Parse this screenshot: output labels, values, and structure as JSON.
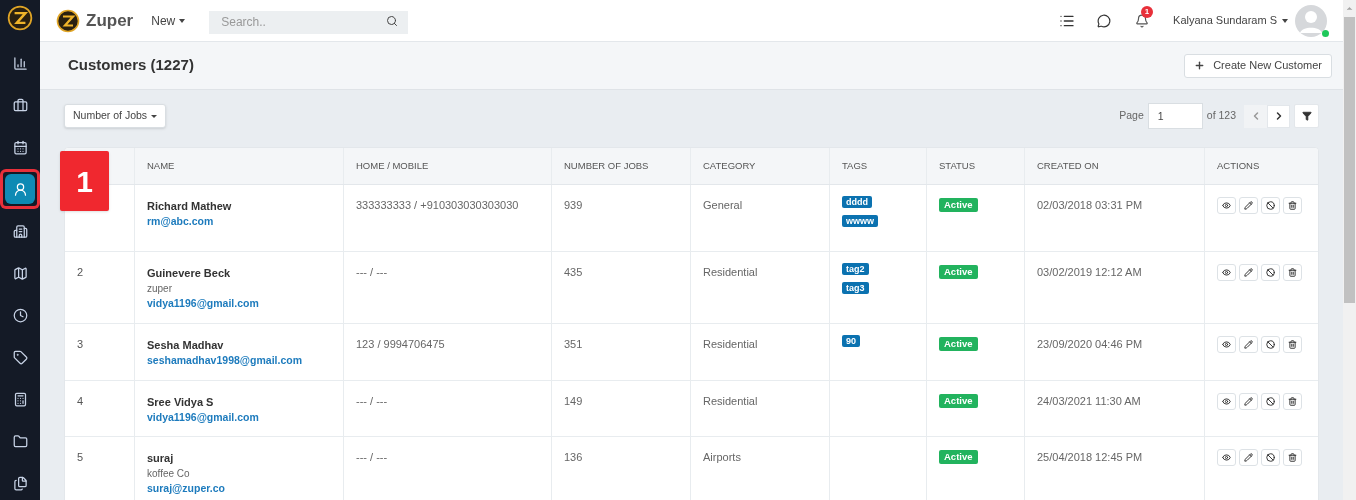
{
  "brand": {
    "name": "Zuper"
  },
  "topbar": {
    "new_menu": "New",
    "search": {
      "placeholder": "Search.."
    },
    "notification_count": "1",
    "user_name": "Kalyana Sundaram S",
    "user_online": true
  },
  "sidebar": {
    "items": [
      {
        "selected": false,
        "highlighted": false
      },
      {
        "selected": false,
        "highlighted": false
      },
      {
        "selected": false,
        "highlighted": false
      },
      {
        "selected": true,
        "highlighted": true
      },
      {
        "selected": false,
        "highlighted": false
      },
      {
        "selected": false,
        "highlighted": false
      },
      {
        "selected": false,
        "highlighted": false
      },
      {
        "selected": false,
        "highlighted": false
      },
      {
        "selected": false,
        "highlighted": false
      },
      {
        "selected": false,
        "highlighted": false
      },
      {
        "selected": false,
        "highlighted": false
      }
    ]
  },
  "page": {
    "title": "Customers (1227)",
    "create_button": "Create New Customer"
  },
  "toolbar": {
    "sort_menu": "Number of Jobs",
    "page_label": "Page",
    "page_value": "1",
    "page_total": "of 123"
  },
  "callout": {
    "label": "1"
  },
  "table": {
    "columns": [
      "NAME",
      "HOME / MOBILE",
      "NUMBER OF JOBS",
      "CATEGORY",
      "TAGS",
      "STATUS",
      "CREATED ON",
      "ACTIONS"
    ],
    "rows": [
      {
        "name": "Richard Mathew",
        "email": "rm@abc.com",
        "phone": "333333333 / +910303030303030",
        "jobs": "939",
        "category": "General",
        "tags": [
          "dddd",
          "wwww"
        ],
        "status": "Active",
        "created": "02/03/2018 03:31 PM"
      },
      {
        "index": "2",
        "name": "Guinevere Beck",
        "company": "zuper",
        "email": "vidya1196@gmail.com",
        "phone": "--- / ---",
        "jobs": "435",
        "category": "Residential",
        "tags": [
          "tag2",
          "tag3"
        ],
        "status": "Active",
        "created": "03/02/2019 12:12 AM"
      },
      {
        "index": "3",
        "name": "Sesha Madhav",
        "email": "seshamadhav1998@gmail.com",
        "phone": "123 / 9994706475",
        "jobs": "351",
        "category": "Residential",
        "tags": [
          "90"
        ],
        "status": "Active",
        "created": "23/09/2020 04:46 PM"
      },
      {
        "index": "4",
        "name": "Sree Vidya S",
        "email": "vidya1196@gmail.com",
        "phone": "--- / ---",
        "jobs": "149",
        "category": "Residential",
        "status": "Active",
        "created": "24/03/2021 11:30 AM"
      },
      {
        "index": "5",
        "name": "suraj",
        "company": "koffee Co",
        "email": "suraj@zuper.co",
        "phone": "--- / ---",
        "jobs": "136",
        "category": "Airports",
        "status": "Active",
        "created": "25/04/2018 12:45 PM"
      }
    ]
  }
}
